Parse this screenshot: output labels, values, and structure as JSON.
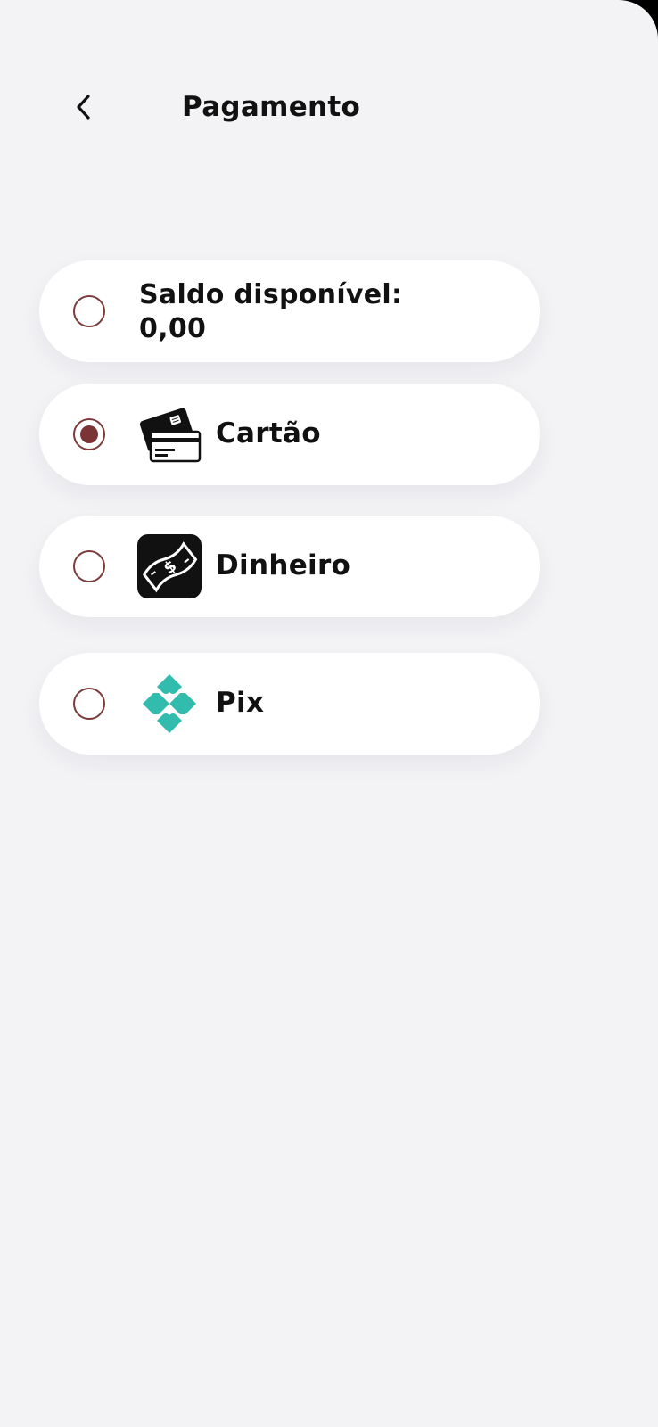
{
  "header": {
    "title": "Pagamento",
    "back_icon": "chevron-left-icon"
  },
  "payment_options": [
    {
      "id": "saldo",
      "label": "Saldo disponível:",
      "value": "0,00",
      "selected": false
    },
    {
      "id": "cartao",
      "label": "Cartão",
      "icon": "credit-card-icon",
      "selected": true
    },
    {
      "id": "dinheiro",
      "label": "Dinheiro",
      "icon": "cash-bill-icon",
      "selected": false
    },
    {
      "id": "pix",
      "label": "Pix",
      "icon": "pix-logo-icon",
      "selected": false
    }
  ],
  "colors": {
    "background": "#f3f3f6",
    "card": "#ffffff",
    "radio_accent": "#7a3436",
    "pix_teal": "#32bcad",
    "text": "#111111"
  }
}
